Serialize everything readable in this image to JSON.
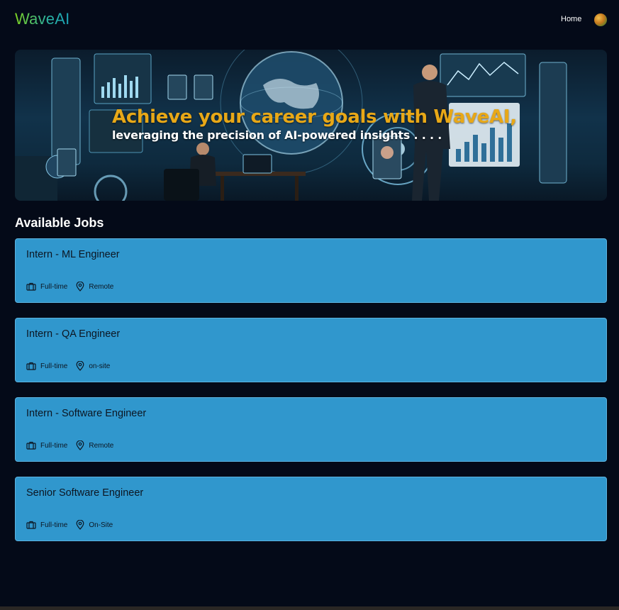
{
  "brand": {
    "logo": "WaveAI"
  },
  "nav": {
    "home": "Home"
  },
  "hero": {
    "title": "Achieve your career goals with WaveAI,",
    "subtitle": "leveraging the precision of AI-powered insights . . . ."
  },
  "section": {
    "title": "Available Jobs"
  },
  "jobs": [
    {
      "title": "Intern - ML Engineer",
      "type": "Full-time",
      "location": "Remote"
    },
    {
      "title": "Intern - QA Engineer",
      "type": "Full-time",
      "location": "on-site"
    },
    {
      "title": "Intern - Software Engineer",
      "type": "Full-time",
      "location": "Remote"
    },
    {
      "title": "Senior Software Engineer",
      "type": "Full-time",
      "location": "On-Site"
    }
  ],
  "icons": {
    "job_type": "briefcase-icon",
    "location": "map-pin-icon"
  },
  "colors": {
    "background": "#040a18",
    "card": "#3097cd",
    "hero_title": "#e8a817",
    "logo_start": "#7ed321",
    "logo_end": "#1aa3b8"
  }
}
